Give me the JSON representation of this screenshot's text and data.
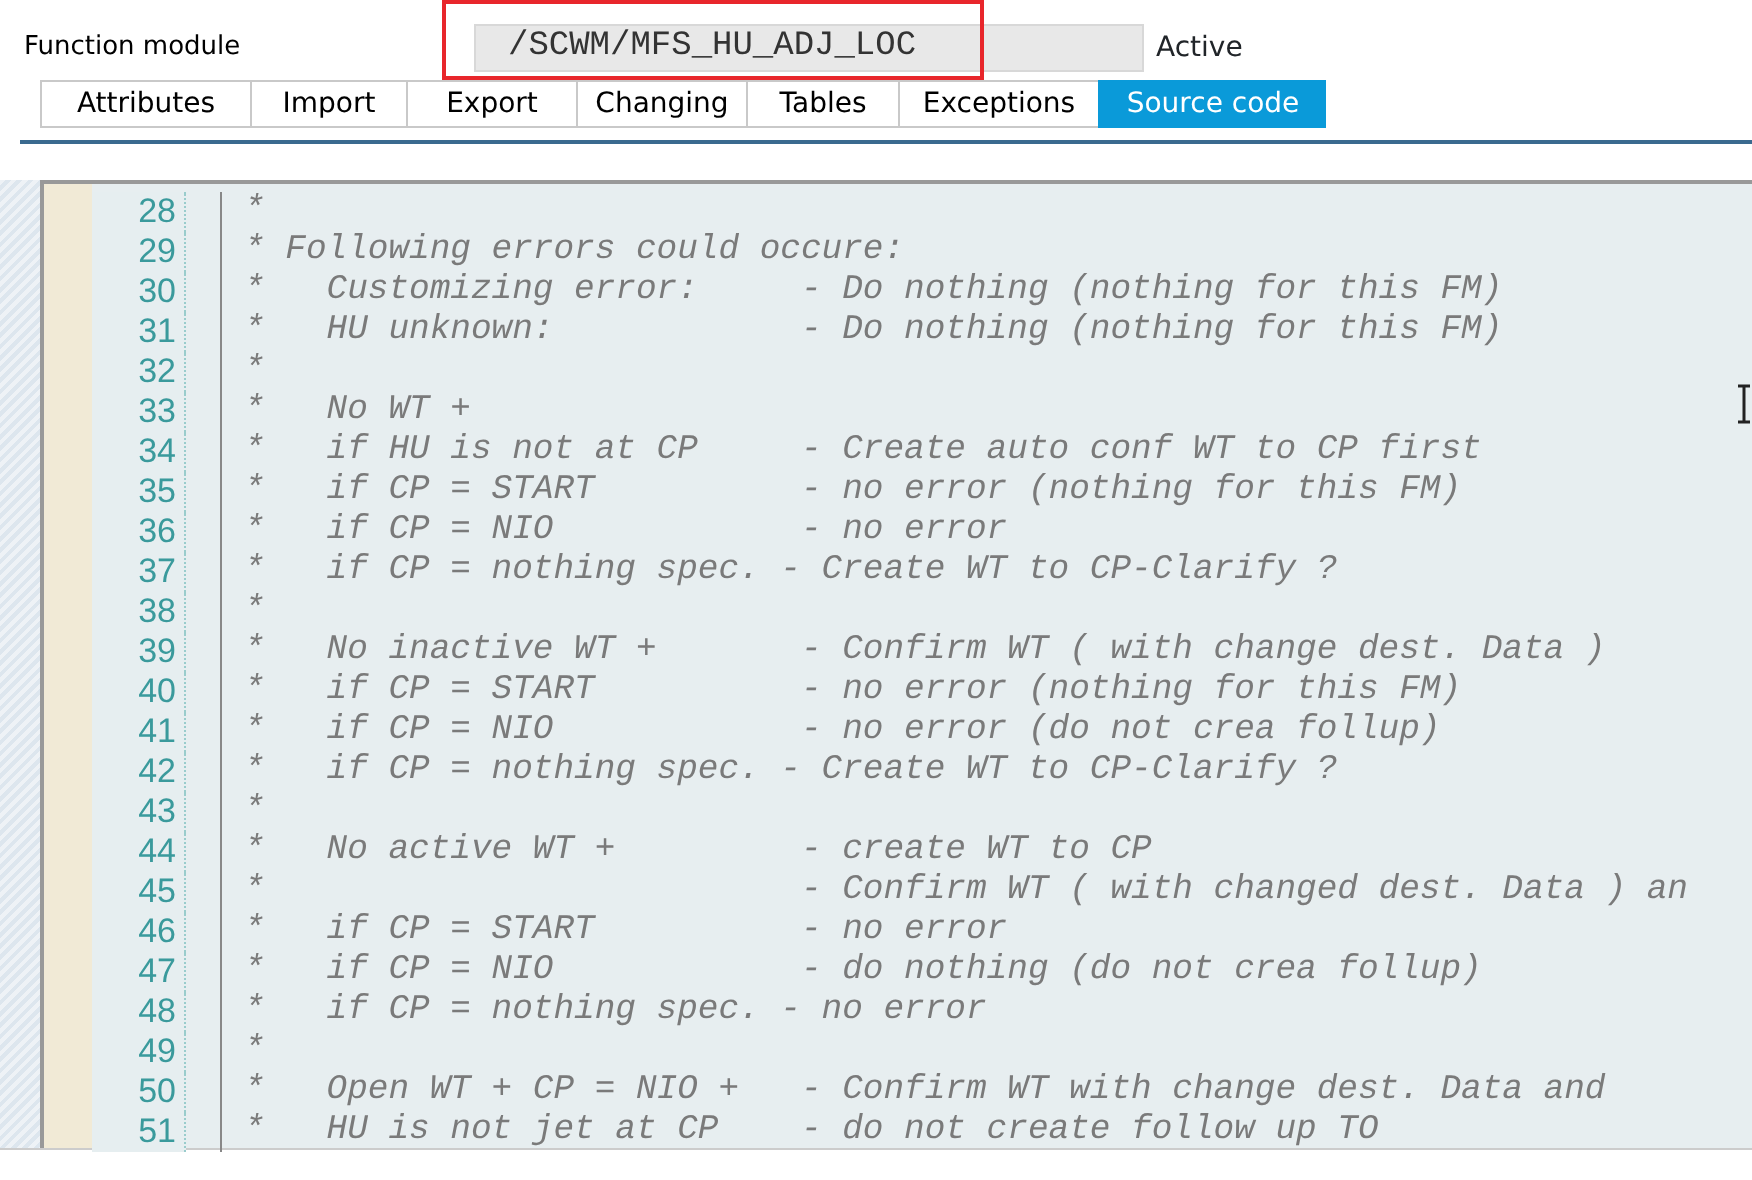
{
  "header": {
    "label": "Function module",
    "value": "/SCWM/MFS_HU_ADJ_LOC",
    "status": "Active"
  },
  "tabs": [
    {
      "label": "Attributes",
      "selected": false
    },
    {
      "label": "Import",
      "selected": false
    },
    {
      "label": "Export",
      "selected": false
    },
    {
      "label": "Changing",
      "selected": false
    },
    {
      "label": "Tables",
      "selected": false
    },
    {
      "label": "Exceptions",
      "selected": false
    },
    {
      "label": "Source code",
      "selected": true
    }
  ],
  "code_lines": [
    {
      "number": "28",
      "text": "*"
    },
    {
      "number": "29",
      "text": "* Following errors could occure:"
    },
    {
      "number": "30",
      "text": "*   Customizing error:     - Do nothing (nothing for this FM)"
    },
    {
      "number": "31",
      "text": "*   HU unknown:            - Do nothing (nothing for this FM)"
    },
    {
      "number": "32",
      "text": "*"
    },
    {
      "number": "33",
      "text": "*   No WT +"
    },
    {
      "number": "34",
      "text": "*   if HU is not at CP     - Create auto conf WT to CP first"
    },
    {
      "number": "35",
      "text": "*   if CP = START          - no error (nothing for this FM)"
    },
    {
      "number": "36",
      "text": "*   if CP = NIO            - no error"
    },
    {
      "number": "37",
      "text": "*   if CP = nothing spec. - Create WT to CP-Clarify ?"
    },
    {
      "number": "38",
      "text": "*"
    },
    {
      "number": "39",
      "text": "*   No inactive WT +       - Confirm WT ( with change dest. Data )"
    },
    {
      "number": "40",
      "text": "*   if CP = START          - no error (nothing for this FM)"
    },
    {
      "number": "41",
      "text": "*   if CP = NIO            - no error (do not crea follup)"
    },
    {
      "number": "42",
      "text": "*   if CP = nothing spec. - Create WT to CP-Clarify ?"
    },
    {
      "number": "43",
      "text": "*"
    },
    {
      "number": "44",
      "text": "*   No active WT +         - create WT to CP"
    },
    {
      "number": "45",
      "text": "*                          - Confirm WT ( with changed dest. Data ) an"
    },
    {
      "number": "46",
      "text": "*   if CP = START          - no error"
    },
    {
      "number": "47",
      "text": "*   if CP = NIO            - do nothing (do not crea follup)"
    },
    {
      "number": "48",
      "text": "*   if CP = nothing spec. - no error"
    },
    {
      "number": "49",
      "text": "*"
    },
    {
      "number": "50",
      "text": "*   Open WT + CP = NIO +   - Confirm WT with change dest. Data and"
    },
    {
      "number": "51",
      "text": "*   HU is not jet at CP    - do not create follow up TO"
    }
  ]
}
